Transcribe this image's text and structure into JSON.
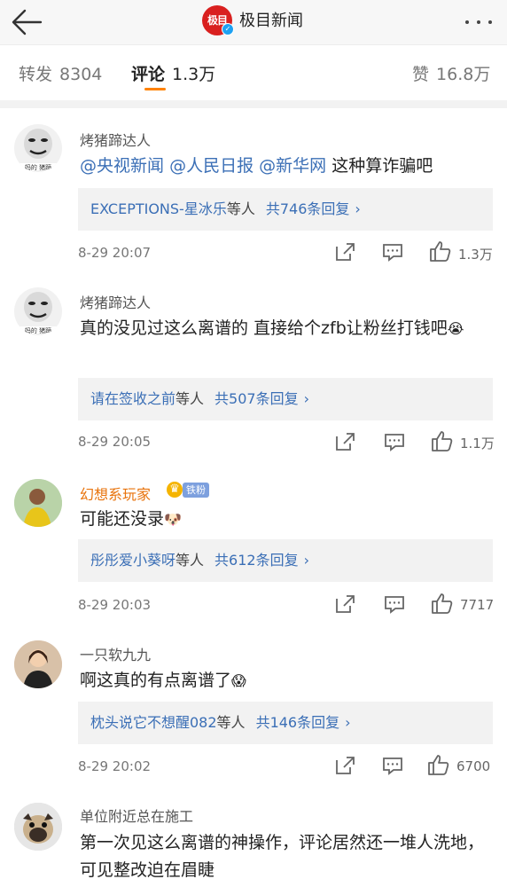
{
  "header": {
    "back_icon": "arrow-left-icon",
    "logo_text": "极目",
    "title": "极目新闻",
    "more_icon": "more-dots-icon"
  },
  "tabs": [
    {
      "label": "转发",
      "count": "8304"
    },
    {
      "label": "评论",
      "count": "1.3万"
    },
    {
      "label": "赞",
      "count": "16.8万"
    }
  ],
  "accent_color": "#ff8200",
  "link_color": "#3b6fb6",
  "comments": [
    {
      "user": "烤猪蹄达人",
      "text_mentions": [
        "@央视新闻",
        "@人民日报",
        "@新华网"
      ],
      "text_rest": "这种算诈骗吧",
      "reply_names": "EXCEPTIONS-星冰乐",
      "reply_deng": "等人",
      "reply_count": "共746条回复",
      "time": "8-29 20:07",
      "likes": "1.3万"
    },
    {
      "user": "烤猪蹄达人",
      "text": "真的没见过这么离谱的 直接给个zfb让粉丝打钱吧",
      "emoji": "😭",
      "reply_names": "请在签收之前",
      "reply_deng": "等人",
      "reply_count": "共507条回复",
      "time": "8-29 20:05",
      "likes": "1.1万"
    },
    {
      "user": "幻想系玩家",
      "badge": "铁粉",
      "text": "可能还没录",
      "emoji": "🐶",
      "reply_names": "彤彤爱小葵呀",
      "reply_deng": "等人",
      "reply_count": "共612条回复",
      "time": "8-29 20:03",
      "likes": "7717"
    },
    {
      "user": "一只软九九",
      "text": "啊这真的有点离谱了",
      "emoji": "😱",
      "reply_names": "枕头说它不想醒082",
      "reply_deng": "等人",
      "reply_count": "共146条回复",
      "time": "8-29 20:02",
      "likes": "6700"
    },
    {
      "user": "单位附近总在施工",
      "text": "第一次见这么离谱的神操作，评论居然还一堆人洗地，可见整改迫在眉睫"
    }
  ]
}
